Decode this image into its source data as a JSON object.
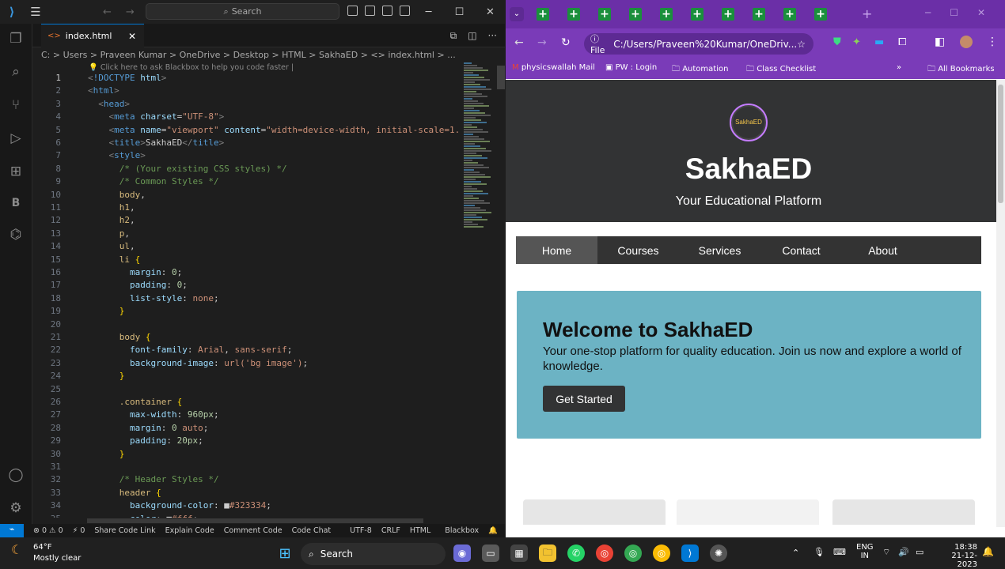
{
  "vscode": {
    "search": "Search",
    "tab": "index.html",
    "breadcrumb": "C: > Users > Praveen Kumar > OneDrive > Desktop > HTML > SakhaED > <> index.html > ...",
    "hint": "Click here to ask Blackbox to help you code faster |",
    "status": [
      "⊗ 0 ⚠ 0",
      "⚡ 0",
      "Share Code Link",
      "Explain Code",
      "Comment Code",
      "Code Chat",
      "UTF-8",
      "CRLF",
      "HTML",
      "Blackbox",
      "🔔"
    ]
  },
  "chrome": {
    "address": "C:/Users/Praveen%20Kumar/OneDriv...",
    "file_chip": "File",
    "bookmarks": [
      "physicswallah Mail",
      "PW : Login",
      "Automation",
      "Class Checklist"
    ],
    "all_bookmarks": "All Bookmarks"
  },
  "site": {
    "logo_text": "SakhaED",
    "title": "SakhaED",
    "subtitle": "Your Educational Platform",
    "nav": [
      "Home",
      "Courses",
      "Services",
      "Contact",
      "About"
    ],
    "hero_title": "Welcome to SakhaED",
    "hero_text": "Your one-stop platform for quality education. Join us now and explore a world of knowledge.",
    "cta": "Get Started"
  },
  "taskbar": {
    "temp": "64°F",
    "weather": "Mostly clear",
    "search": "Search",
    "lang": "ENG",
    "region": "IN",
    "time": "18:38",
    "date": "21-12-2023"
  }
}
